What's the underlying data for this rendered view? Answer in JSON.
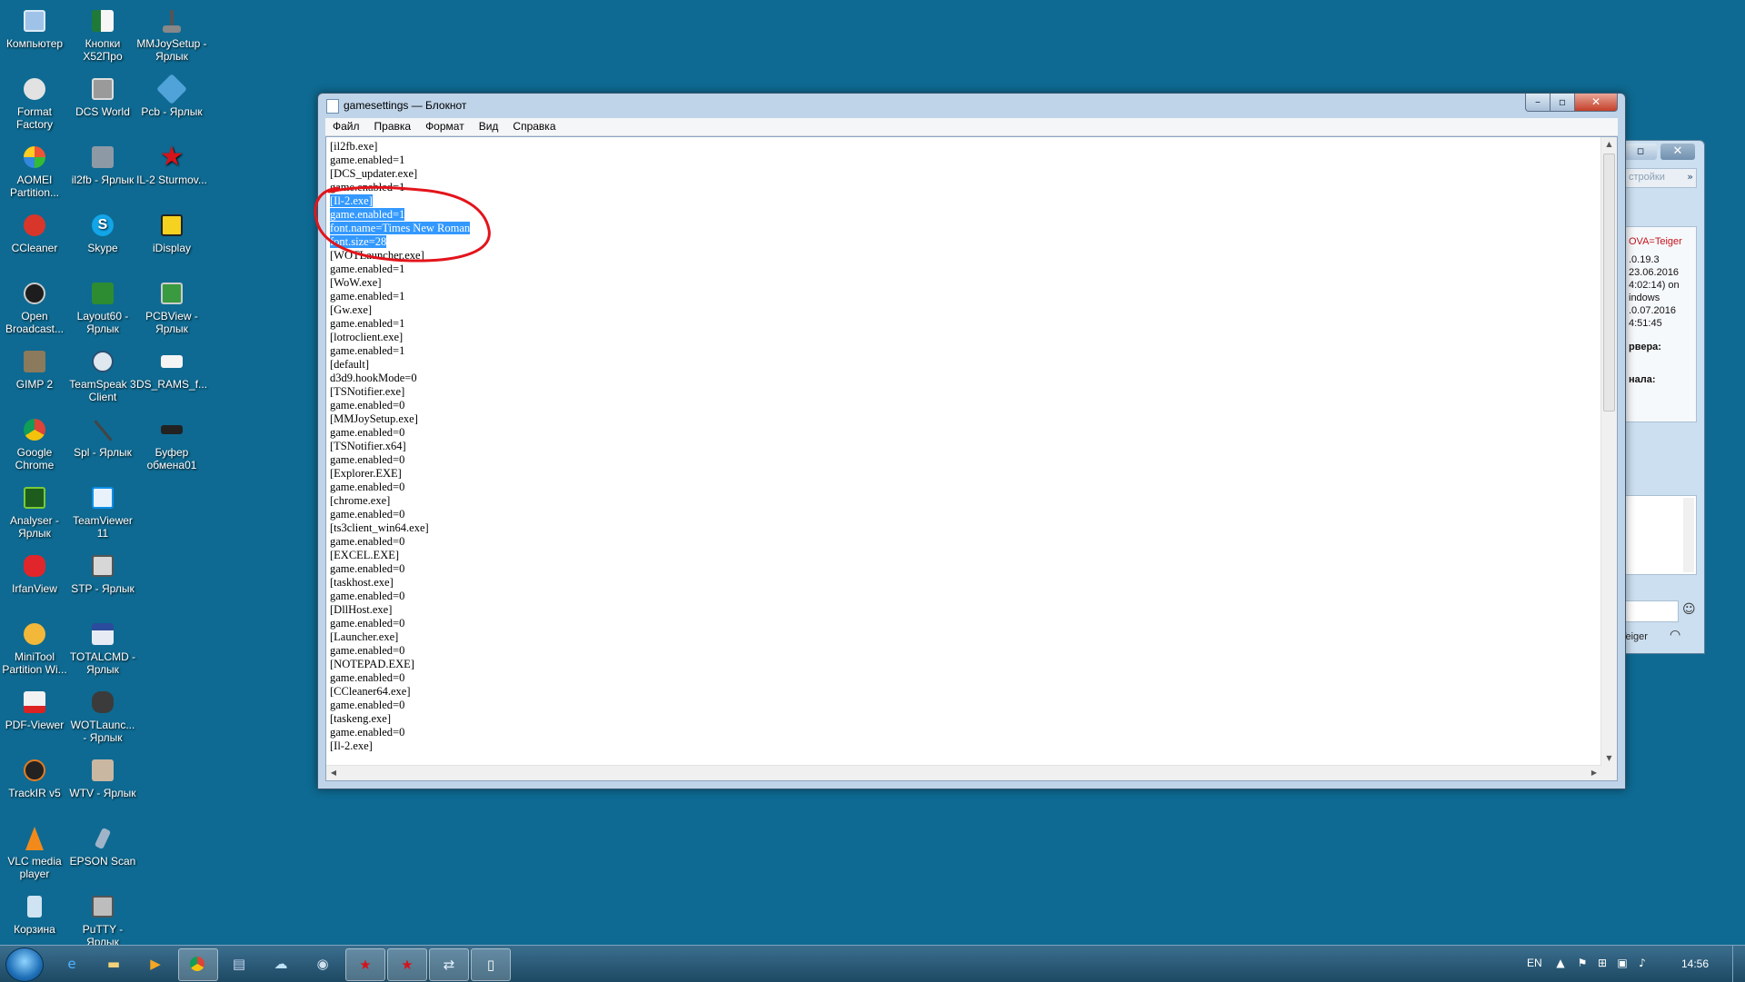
{
  "desktop": {
    "icons": [
      {
        "label": "Компьютер"
      },
      {
        "label": "Кнопки X52Про"
      },
      {
        "label": "MMJoySetup - Ярлык"
      },
      {
        "label": "Format Factory"
      },
      {
        "label": "DCS World"
      },
      {
        "label": "Pcb - Ярлык"
      },
      {
        "label": "AOMEI Partition..."
      },
      {
        "label": "il2fb - Ярлык"
      },
      {
        "label": "IL-2 Sturmov..."
      },
      {
        "label": "CCleaner"
      },
      {
        "label": "Skype"
      },
      {
        "label": "iDisplay"
      },
      {
        "label": "Open Broadcast..."
      },
      {
        "label": "Layout60 - Ярлык"
      },
      {
        "label": "PCBView - Ярлык"
      },
      {
        "label": "GIMP 2"
      },
      {
        "label": "TeamSpeak 3 Client"
      },
      {
        "label": "DS_RAMS_f..."
      },
      {
        "label": "Google Chrome"
      },
      {
        "label": "Spl - Ярлык"
      },
      {
        "label": "Буфер обмена01"
      },
      {
        "label": "Analyser - Ярлык"
      },
      {
        "label": "TeamViewer 11"
      },
      {
        "label": "IrfanView"
      },
      {
        "label": "STP - Ярлык"
      },
      {
        "label": "MiniTool Partition Wi..."
      },
      {
        "label": "TOTALCMD - Ярлык"
      },
      {
        "label": "PDF-Viewer"
      },
      {
        "label": "WOTLaunc... - Ярлык"
      },
      {
        "label": "TrackIR v5"
      },
      {
        "label": "WTV - Ярлык"
      },
      {
        "label": "VLC media player"
      },
      {
        "label": "EPSON Scan"
      },
      {
        "label": "Корзина"
      },
      {
        "label": "PuTTY - Ярлык"
      }
    ]
  },
  "notepad": {
    "title": "gamesettings — Блокнот",
    "menu": [
      "Файл",
      "Правка",
      "Формат",
      "Вид",
      "Справка"
    ],
    "lines": [
      "[il2fb.exe]",
      "game.enabled=1",
      "[DCS_updater.exe]",
      "game.enabled=1",
      "[Il-2.exe]",
      "game.enabled=1",
      "font.name=Times New Roman",
      "font.size=28",
      "[WOTLauncher.exe]",
      "game.enabled=1",
      "[WoW.exe]",
      "game.enabled=1",
      "[Gw.exe]",
      "game.enabled=1",
      "[lotroclient.exe]",
      "game.enabled=1",
      "[default]",
      "d3d9.hookMode=0",
      "[TSNotifier.exe]",
      "game.enabled=0",
      "[MMJoySetup.exe]",
      "game.enabled=0",
      "[TSNotifier.x64]",
      "game.enabled=0",
      "[Explorer.EXE]",
      "game.enabled=0",
      "[chrome.exe]",
      "game.enabled=0",
      "[ts3client_win64.exe]",
      "game.enabled=0",
      "[EXCEL.EXE]",
      "game.enabled=0",
      "[taskhost.exe]",
      "game.enabled=0",
      "[DllHost.exe]",
      "game.enabled=0",
      "[Launcher.exe]",
      "game.enabled=0",
      "[NOTEPAD.EXE]",
      "game.enabled=0",
      "[CCleaner64.exe]",
      "game.enabled=0",
      "[taskeng.exe]",
      "game.enabled=0",
      "[Il-2.exe]"
    ],
    "selected_lines": [
      4,
      5,
      6,
      7
    ],
    "annotation_color": "#e3141b"
  },
  "background_window": {
    "toolbar_text": "стройки",
    "rows": [
      "OVA=Teiger",
      ".0.19.3",
      "23.06.2016",
      "4:02:14) on",
      "indows",
      ".0.07.2016",
      "4:51:45",
      "рвера:",
      "нала:"
    ],
    "footer_text": "Teiger"
  },
  "taskbar": {
    "language": "EN",
    "clock": "14:56",
    "apps": [
      "ie-icon",
      "explorer-icon",
      "media-player-icon",
      "chrome-icon",
      "totalcmd-icon",
      "skype-icon",
      "teamspeak-icon",
      "il2-icon",
      "il2-sturmovik-icon",
      "teamviewer-icon",
      "notepad-icon"
    ]
  },
  "colors": {
    "desktop": "#0e6a92",
    "selection": "#3399ff",
    "annotation": "#e3141b"
  }
}
